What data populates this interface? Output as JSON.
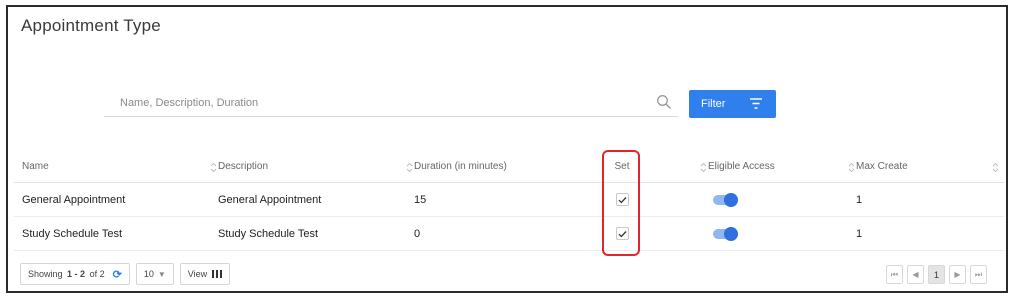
{
  "page": {
    "title": "Appointment Type"
  },
  "search": {
    "placeholder": "Name, Description, Duration",
    "value": ""
  },
  "filter": {
    "label": "Filter"
  },
  "table": {
    "headers": [
      "Name",
      "Description",
      "Duration (in minutes)",
      "Set",
      "Eligible Access",
      "Max Create"
    ],
    "rows": [
      {
        "name": "General Appointment",
        "description": "General Appointment",
        "duration": "15",
        "set": true,
        "eligible_access": true,
        "max_create": "1"
      },
      {
        "name": "Study Schedule Test",
        "description": "Study Schedule Test",
        "duration": "0",
        "set": true,
        "eligible_access": true,
        "max_create": "1"
      }
    ]
  },
  "footer": {
    "showing_prefix": "Showing",
    "showing_range": "1 - 2",
    "showing_of": "of 2",
    "page_size": "10",
    "view_label": "View"
  },
  "pagination": {
    "first": "⏮",
    "prev": "◀",
    "current": "1",
    "next": "▶",
    "last": "⏭"
  },
  "colors": {
    "accent": "#2f80ed",
    "highlight": "#e0262a"
  }
}
